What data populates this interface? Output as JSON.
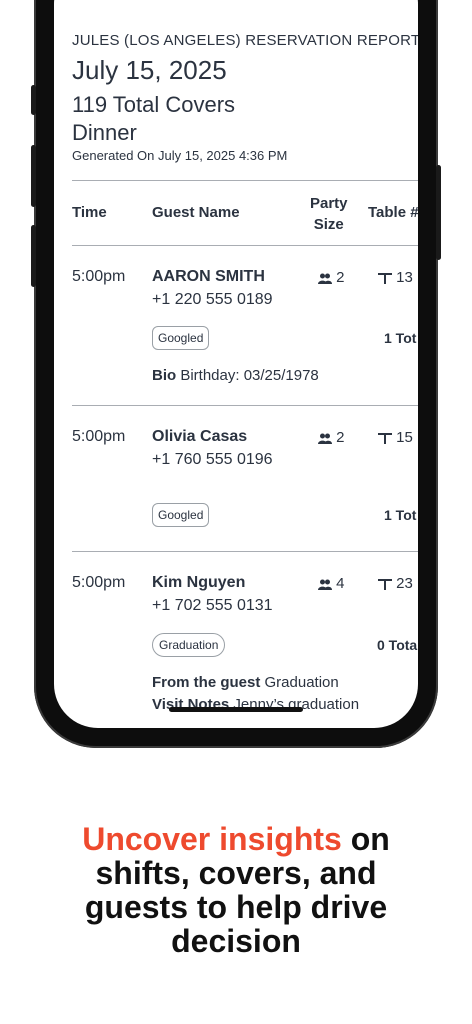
{
  "report": {
    "title": "JULES (LOS ANGELES) RESERVATION REPORT",
    "date": "July 15, 2025",
    "covers": "119 Total Covers",
    "meal": "Dinner",
    "generated": "Generated On July 15, 2025 4:36 PM"
  },
  "table_headers": {
    "time": "Time",
    "guest": "Guest Name",
    "party_line1": "Party",
    "party_line2": "Size",
    "table": "Table #"
  },
  "reservations": [
    {
      "time": "5:00pm",
      "name": "AARON SMITH",
      "phone": "+1 220 555 0189",
      "party": "2",
      "table": "13",
      "tag": "Googled",
      "total": "1 Tot",
      "note1_label": "Bio",
      "note1_value": "Birthday: 03/25/1978"
    },
    {
      "time": "5:00pm",
      "name": "Olivia Casas",
      "phone": "+1 760 555 0196",
      "party": "2",
      "table": "15",
      "tag": "Googled",
      "total": "1 Tot"
    },
    {
      "time": "5:00pm",
      "name": "Kim Nguyen",
      "phone": "+1 702 555 0131",
      "party": "4",
      "table": "23",
      "tag": "Graduation",
      "total": "0 Tota",
      "note1_label": "From the guest",
      "note1_value": "Graduation",
      "note2_label": "Visit Notes",
      "note2_value": "Jenny’s graduation"
    }
  ],
  "headline": {
    "accent": "Uncover insights",
    "rest_line1": " on",
    "line2": "shifts, covers, and",
    "line3": "guests to help drive",
    "line4": "decision"
  },
  "colors": {
    "accent": "#ee4a2e",
    "text": "#2b3340"
  }
}
